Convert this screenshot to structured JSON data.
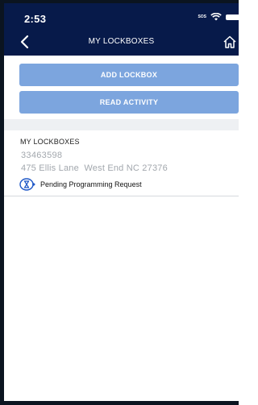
{
  "status_bar": {
    "time": "2:53",
    "sos": "SOS"
  },
  "header": {
    "title": "MY LOCKBOXES",
    "back_icon": "chevron-left-icon",
    "home_icon": "home-icon"
  },
  "actions": {
    "add_label": "ADD LOCKBOX",
    "read_label": "READ ACTIVITY"
  },
  "section": {
    "title": "MY LOCKBOXES"
  },
  "lockboxes": [
    {
      "id": "33463598",
      "address": "475 Ellis Lane  West End NC 27376",
      "status": "Pending Programming Request",
      "status_icon": "hourglass-icon"
    }
  ],
  "colors": {
    "header_bg": "#071a4a",
    "button_bg": "#7ca5de",
    "muted_text": "#a2a7ad",
    "accent": "#1f58c7"
  }
}
